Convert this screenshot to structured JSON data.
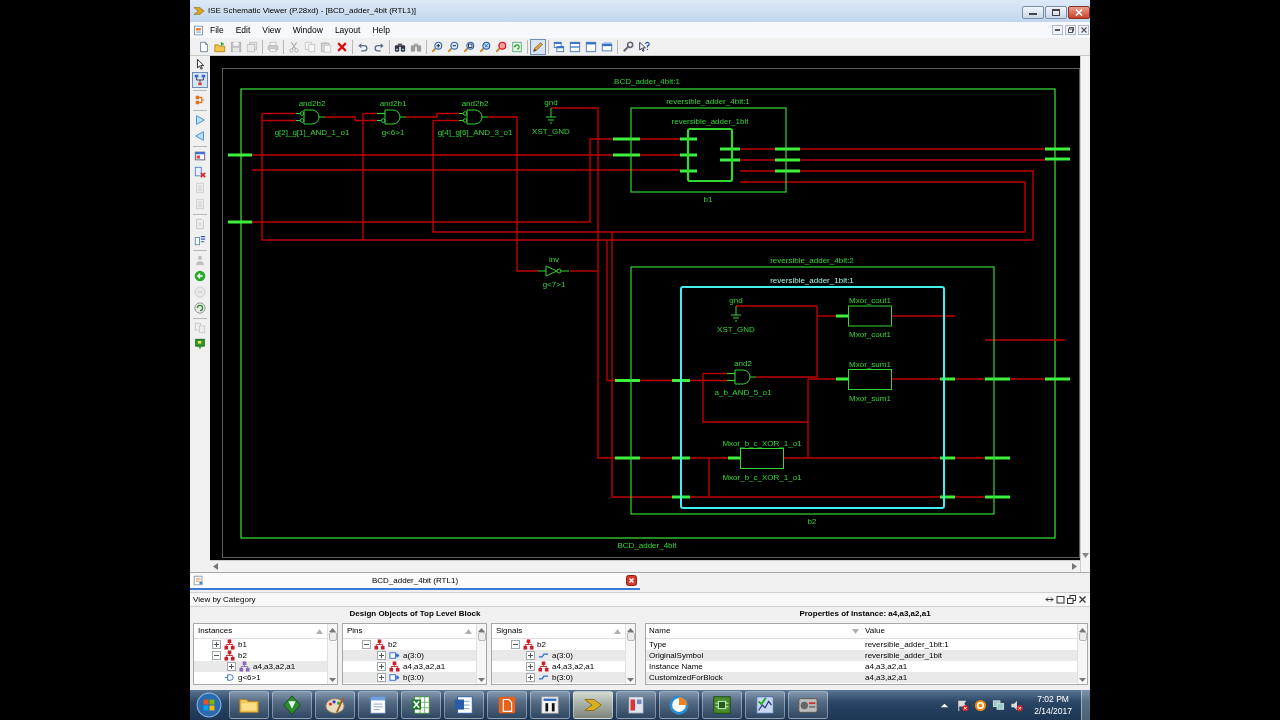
{
  "window": {
    "title": "ISE Schematic Viewer (P.28xd) - [BCD_adder_4bit (RTL1)]"
  },
  "menu": [
    "File",
    "Edit",
    "View",
    "Window",
    "Layout",
    "Help"
  ],
  "toolbar": [
    [
      {
        "kind": "new",
        "disabled": false,
        "pressed": false
      },
      {
        "kind": "open",
        "disabled": false,
        "pressed": false
      },
      {
        "kind": "save",
        "disabled": true,
        "pressed": false
      },
      {
        "kind": "save-all",
        "disabled": true,
        "pressed": false
      }
    ],
    [
      {
        "kind": "print",
        "disabled": true,
        "pressed": false
      }
    ],
    [
      {
        "kind": "cut",
        "disabled": true,
        "pressed": false
      },
      {
        "kind": "copy",
        "disabled": true,
        "pressed": false
      },
      {
        "kind": "paste",
        "disabled": true,
        "pressed": false
      },
      {
        "kind": "delete",
        "disabled": false,
        "pressed": false
      }
    ],
    [
      {
        "kind": "undo",
        "disabled": false,
        "pressed": false
      },
      {
        "kind": "redo",
        "disabled": false,
        "pressed": false
      }
    ],
    [
      {
        "kind": "find",
        "disabled": false,
        "pressed": false
      },
      {
        "kind": "find-next",
        "disabled": true,
        "pressed": false
      }
    ],
    [
      {
        "kind": "zoom-in",
        "disabled": false,
        "pressed": false
      },
      {
        "kind": "zoom-out",
        "disabled": false,
        "pressed": false
      },
      {
        "kind": "zoom-fit",
        "disabled": false,
        "pressed": false
      },
      {
        "kind": "zoom-full",
        "disabled": false,
        "pressed": false
      },
      {
        "kind": "zoom-select",
        "disabled": false,
        "pressed": false
      },
      {
        "kind": "refresh",
        "disabled": false,
        "pressed": false
      }
    ],
    [
      {
        "kind": "pen",
        "disabled": false,
        "pressed": true
      }
    ],
    [
      {
        "kind": "cascade",
        "disabled": false,
        "pressed": false
      },
      {
        "kind": "tile-horizontal",
        "disabled": false,
        "pressed": false
      },
      {
        "kind": "tile-vertical",
        "disabled": false,
        "pressed": false
      },
      {
        "kind": "window",
        "disabled": false,
        "pressed": false
      }
    ],
    [
      {
        "kind": "wrench",
        "disabled": false,
        "pressed": false
      },
      {
        "kind": "help",
        "disabled": false,
        "pressed": false
      }
    ]
  ],
  "left_toolbar": [
    [
      {
        "kind": "select",
        "disabled": false,
        "pressed": false
      },
      {
        "kind": "hierarchy",
        "disabled": false,
        "pressed": true
      }
    ],
    [
      {
        "kind": "branch",
        "disabled": false,
        "pressed": false
      }
    ],
    [
      {
        "kind": "expand-right",
        "disabled": false,
        "pressed": false
      },
      {
        "kind": "expand-left",
        "disabled": false,
        "pressed": false
      }
    ],
    [
      {
        "kind": "view-window",
        "disabled": false,
        "pressed": false
      },
      {
        "kind": "page-delete",
        "disabled": false,
        "pressed": false
      },
      {
        "kind": "page",
        "disabled": true,
        "pressed": false
      },
      {
        "kind": "page",
        "disabled": true,
        "pressed": false
      }
    ],
    [
      {
        "kind": "document",
        "disabled": true,
        "pressed": false
      },
      {
        "kind": "text-lines",
        "disabled": false,
        "pressed": false
      }
    ],
    [
      {
        "kind": "person",
        "disabled": true,
        "pressed": false
      },
      {
        "kind": "back",
        "disabled": false,
        "pressed": false
      },
      {
        "kind": "circle",
        "disabled": true,
        "pressed": false
      },
      {
        "kind": "cycle",
        "disabled": false,
        "pressed": false
      }
    ],
    [
      {
        "kind": "pages",
        "disabled": true,
        "pressed": false
      },
      {
        "kind": "marker",
        "disabled": false,
        "pressed": false
      }
    ]
  ],
  "schematic": {
    "top": {
      "title": "BCD_adder_4bit:1",
      "name": "BCD_adder_4bit"
    },
    "gates": [
      {
        "kind": "and",
        "type": "and2b2",
        "instance": "g[2]_g[1]_AND_1_o1",
        "inputs": [
          {
            "inverted": true
          },
          {
            "inverted": true
          }
        ]
      },
      {
        "kind": "and",
        "type": "and2b1",
        "instance": "g<6>1",
        "inputs": [
          {
            "inverted": false
          },
          {
            "inverted": true
          }
        ]
      },
      {
        "kind": "and",
        "type": "and2b2",
        "instance": "g[4]_g[6]_AND_3_o1",
        "inputs": [
          {
            "inverted": true
          },
          {
            "inverted": true
          }
        ]
      },
      {
        "kind": "ground",
        "type": "gnd",
        "instance": "XST_GND"
      },
      {
        "kind": "inverter",
        "type": "inv",
        "instance": "g<7>1"
      }
    ],
    "blocks": [
      {
        "title": "reversible_adder_4bit:1",
        "inner_title": "reversible_adder_1bit",
        "name": "b1",
        "selected": false
      },
      {
        "title": "reversible_adder_4bit:2",
        "inner_title": "reversible_adder_1bit:1",
        "name": "b2",
        "selected": true,
        "parts": [
          {
            "kind": "ground",
            "type": "gnd",
            "instance": "XST_GND"
          },
          {
            "kind": "box",
            "type": "Mxor_cout1",
            "instance": "Mxor_cout1"
          },
          {
            "kind": "and",
            "type": "and2",
            "instance": "a_b_AND_5_o1",
            "inputs": [
              {
                "inverted": false
              },
              {
                "inverted": false
              }
            ]
          },
          {
            "kind": "box",
            "type": "Mxor_sum1",
            "instance": "Mxor_sum1"
          },
          {
            "kind": "box",
            "type": "Mxor_b_c_XOR_1_o1",
            "instance": "Mxor_b_c_XOR_1_o1"
          }
        ]
      }
    ]
  },
  "documents": [
    {
      "label": "BCD_adder_4bit (RTL1)",
      "selected": true
    }
  ],
  "view_by": "View by Category",
  "design_objects": {
    "title": "Design Objects of Top Level Block",
    "panes": [
      {
        "header": "Instances",
        "items": [
          {
            "label": "b1",
            "kind": "block",
            "expanded": false,
            "selected": false
          },
          {
            "label": "b2",
            "kind": "block",
            "expanded": true,
            "selected": false,
            "children": [
              {
                "label": "a4,a3,a2,a1",
                "kind": "instance",
                "expanded": false,
                "selected": true
              }
            ]
          },
          {
            "label": "g<6>1",
            "kind": "gate",
            "selected": false
          }
        ]
      },
      {
        "header": "Pins",
        "items": [
          {
            "label": "b2",
            "kind": "block",
            "expanded": true,
            "children": [
              {
                "label": "a(3:0)",
                "kind": "pin",
                "expanded": false
              },
              {
                "label": "a4,a3,a2,a1",
                "kind": "block",
                "expanded": false
              },
              {
                "label": "b(3:0)",
                "kind": "pin",
                "expanded": false
              }
            ]
          }
        ]
      },
      {
        "header": "Signals",
        "items": [
          {
            "label": "b2",
            "kind": "block",
            "expanded": true,
            "children": [
              {
                "label": "a(3:0)",
                "kind": "signal",
                "expanded": false
              },
              {
                "label": "a4,a3,a2,a1",
                "kind": "block",
                "expanded": false
              },
              {
                "label": "b(3:0)",
                "kind": "signal",
                "expanded": false
              }
            ]
          }
        ]
      }
    ]
  },
  "properties": {
    "title": "Properties of Instance: a4,a3,a2,a1",
    "columns": [
      "Name",
      "Value"
    ],
    "rows": [
      [
        "Type",
        "reversible_adder_1bit:1"
      ],
      [
        "OriginalSymbol",
        "reversible_adder_1bit"
      ],
      [
        "Instance Name",
        "a4,a3,a2,a1"
      ],
      [
        "CustomizedForBlock",
        "a4,a3,a2,a1"
      ]
    ]
  },
  "taskbar": {
    "apps": [
      {
        "kind": "folder",
        "active": false
      },
      {
        "kind": "editor",
        "active": false
      },
      {
        "kind": "paint",
        "active": false
      },
      {
        "kind": "wordpad",
        "active": false
      },
      {
        "kind": "spreadsheet",
        "active": false
      },
      {
        "kind": "word",
        "active": false
      },
      {
        "kind": "pdf",
        "active": false
      },
      {
        "kind": "m-app",
        "active": false
      },
      {
        "kind": "ise",
        "active": true
      },
      {
        "kind": "device",
        "active": false
      },
      {
        "kind": "ring",
        "active": false
      },
      {
        "kind": "chip",
        "active": false
      },
      {
        "kind": "chart",
        "active": false
      },
      {
        "kind": "radio",
        "active": false
      }
    ],
    "tray": [
      {
        "kind": "caret"
      },
      {
        "kind": "flag"
      },
      {
        "kind": "ring"
      },
      {
        "kind": "network"
      },
      {
        "kind": "volume-muted"
      }
    ],
    "time": "7:02 PM",
    "date": "2/14/2017"
  }
}
